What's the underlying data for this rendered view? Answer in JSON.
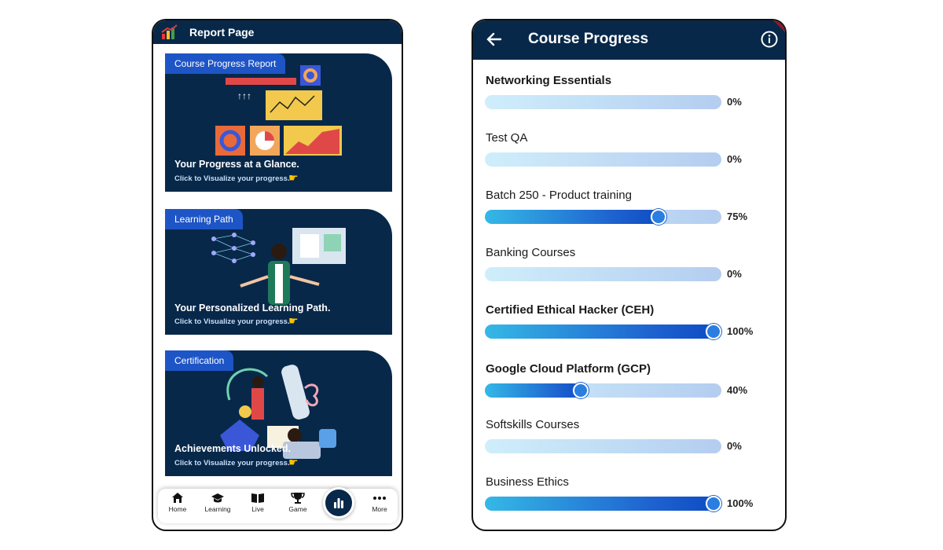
{
  "left": {
    "header_title": "Report Page",
    "cards": [
      {
        "tag": "Course Progress Report",
        "title": "Your Progress at a Glance.",
        "subtitle": "Click to Visualize your progress."
      },
      {
        "tag": "Learning Path",
        "title": "Your Personalized Learning Path.",
        "subtitle": "Click to Visualize your progress."
      },
      {
        "tag": "Certification",
        "title": "Achievements Unlocked.",
        "subtitle": "Click to Visualize your progress."
      }
    ],
    "nav": [
      {
        "label": "Home",
        "icon": "home-icon"
      },
      {
        "label": "Learning",
        "icon": "graduation-cap-icon"
      },
      {
        "label": "Live",
        "icon": "book-icon"
      },
      {
        "label": "Game",
        "icon": "trophy-icon"
      },
      {
        "label": "More",
        "icon": "more-dots-icon"
      }
    ],
    "fab_icon": "bar-chart-icon"
  },
  "right": {
    "header_title": "Course Progress",
    "courses": [
      {
        "name": "Networking Essentials",
        "progress": 0,
        "label": "0%"
      },
      {
        "name": "Test QA",
        "progress": 0,
        "label": "0%"
      },
      {
        "name": "Batch 250 - Product training",
        "progress": 75,
        "label": "75%"
      },
      {
        "name": "Banking Courses",
        "progress": 0,
        "label": "0%"
      },
      {
        "name": "Certified Ethical Hacker (CEH)",
        "progress": 100,
        "label": "100%"
      },
      {
        "name": "Google Cloud Platform (GCP)",
        "progress": 40,
        "label": "40%"
      },
      {
        "name": "Softskills Courses",
        "progress": 0,
        "label": "0%"
      },
      {
        "name": "Business Ethics",
        "progress": 100,
        "label": "100%"
      }
    ]
  },
  "colors": {
    "navy": "#08284a",
    "tag_blue": "#1e55c6",
    "accent_blue": "#1e63d0"
  }
}
